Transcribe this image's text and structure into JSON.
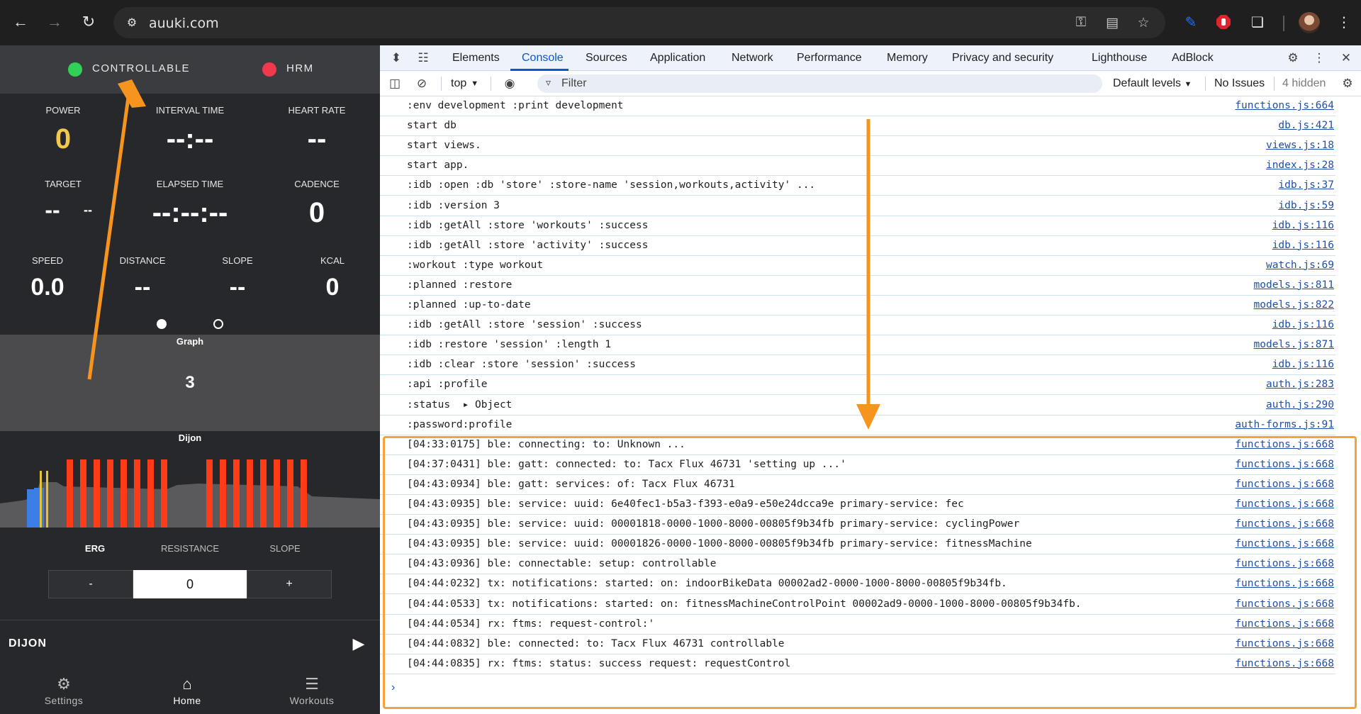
{
  "browser": {
    "url": "auuki.com",
    "icons": [
      "back-arrow-icon",
      "forward-arrow-icon",
      "reload-icon",
      "site-settings-icon",
      "password-key-icon",
      "install-app-icon",
      "bookmark-star-icon",
      "pen-extension-icon",
      "adblock-extension-icon",
      "extensions-puzzle-icon",
      "avatar",
      "kebab-menu-icon"
    ]
  },
  "app": {
    "status": {
      "controllable": "CONTROLLABLE",
      "controllable_color": "#31d158",
      "hrm": "HRM",
      "hrm_color": "#f0384e"
    },
    "metrics": [
      {
        "label": "POWER",
        "value": "0",
        "color": "#f2c94c"
      },
      {
        "label": "INTERVAL TIME",
        "value": "--:--"
      },
      {
        "label": "HEART RATE",
        "value": "--"
      },
      {
        "label": "TARGET",
        "value": "--",
        "secondary": "--"
      },
      {
        "label": "ELAPSED TIME",
        "value": "--:--:--"
      },
      {
        "label": "CADENCE",
        "value": "0"
      },
      {
        "label": "SPEED",
        "value": "0.0"
      },
      {
        "label": "DISTANCE",
        "value": "--"
      },
      {
        "label": "SLOPE",
        "value": "--"
      },
      {
        "label": "KCAL",
        "value": "0"
      }
    ],
    "graph": {
      "title": "Graph",
      "value": "3"
    },
    "workout_graph": {
      "title": "Dijon",
      "bar_color": "#ff3b18",
      "warmup_colors": [
        "#3c7ee8",
        "#e6c43a"
      ]
    },
    "modes": {
      "erg": "ERG",
      "resistance": "RESISTANCE",
      "slope": "SLOPE"
    },
    "control": {
      "minus": "-",
      "value": "0",
      "plus": "+"
    },
    "workout_name": "DIJON",
    "nav": {
      "settings": "Settings",
      "home": "Home",
      "workouts": "Workouts"
    }
  },
  "devtools": {
    "tabs": [
      "Elements",
      "Console",
      "Sources",
      "Application",
      "Network",
      "Performance",
      "Memory",
      "Privacy and security",
      "Lighthouse",
      "AdBlock"
    ],
    "active_tab": "Console",
    "context": "top",
    "filter_placeholder": "Filter",
    "levels": "Default levels",
    "issues": "No Issues",
    "hidden": "4 hidden",
    "logs": [
      {
        "msg": ":env development :print development",
        "src": "functions.js:664"
      },
      {
        "msg": "start db",
        "src": "db.js:421"
      },
      {
        "msg": "start views.",
        "src": "views.js:18"
      },
      {
        "msg": "start app.",
        "src": "index.js:28"
      },
      {
        "msg": ":idb :open :db 'store' :store-name 'session,workouts,activity' ...",
        "src": "idb.js:37"
      },
      {
        "msg": ":idb :version 3",
        "src": "idb.js:59"
      },
      {
        "msg": ":idb :getAll :store 'workouts' :success",
        "src": "idb.js:116"
      },
      {
        "msg": ":idb :getAll :store 'activity' :success",
        "src": "idb.js:116"
      },
      {
        "msg": ":workout :type workout",
        "src": "watch.js:69"
      },
      {
        "msg": ":planned :restore",
        "src": "models.js:811"
      },
      {
        "msg": ":planned :up-to-date",
        "src": "models.js:822"
      },
      {
        "msg": ":idb :getAll :store 'session' :success",
        "src": "idb.js:116"
      },
      {
        "msg": ":idb :restore 'session' :length 1",
        "src": "models.js:871"
      },
      {
        "msg": ":idb :clear :store 'session' :success",
        "src": "idb.js:116"
      },
      {
        "msg": ":api :profile",
        "src": "auth.js:283"
      },
      {
        "msg": ":status  ▸ Object",
        "src": "auth.js:290"
      },
      {
        "msg": ":password:profile",
        "src": "auth-forms.js:91"
      },
      {
        "msg": "[04:33:0175] ble: connecting: to: Unknown ...",
        "src": "functions.js:668"
      },
      {
        "msg": "[04:37:0431] ble: gatt: connected: to: Tacx Flux 46731 'setting up ...'",
        "src": "functions.js:668"
      },
      {
        "msg": "[04:43:0934] ble: gatt: services: of: Tacx Flux 46731",
        "src": "functions.js:668"
      },
      {
        "msg": "[04:43:0935] ble: service: uuid: 6e40fec1-b5a3-f393-e0a9-e50e24dcca9e primary-service: fec",
        "src": "functions.js:668"
      },
      {
        "msg": "[04:43:0935] ble: service: uuid: 00001818-0000-1000-8000-00805f9b34fb primary-service: cyclingPower",
        "src": "functions.js:668"
      },
      {
        "msg": "[04:43:0935] ble: service: uuid: 00001826-0000-1000-8000-00805f9b34fb primary-service: fitnessMachine",
        "src": "functions.js:668"
      },
      {
        "msg": "[04:43:0936] ble: connectable: setup: controllable",
        "src": "functions.js:668"
      },
      {
        "msg": "[04:44:0232] tx: notifications: started: on: indoorBikeData 00002ad2-0000-1000-8000-00805f9b34fb.",
        "src": "functions.js:668"
      },
      {
        "msg": "[04:44:0533] tx: notifications: started: on: fitnessMachineControlPoint 00002ad9-0000-1000-8000-00805f9b34fb.",
        "src": "functions.js:668"
      },
      {
        "msg": "[04:44:0534] rx: ftms: request-control:'",
        "src": "functions.js:668"
      },
      {
        "msg": "[04:44:0832] ble: connected: to: Tacx Flux 46731 controllable",
        "src": "functions.js:668"
      },
      {
        "msg": "[04:44:0835] rx: ftms: status: success request: requestControl",
        "src": "functions.js:668"
      }
    ],
    "prompt": "›"
  },
  "annotations": {
    "color": "#f7941d",
    "highlight_color": "#f5a23a"
  }
}
